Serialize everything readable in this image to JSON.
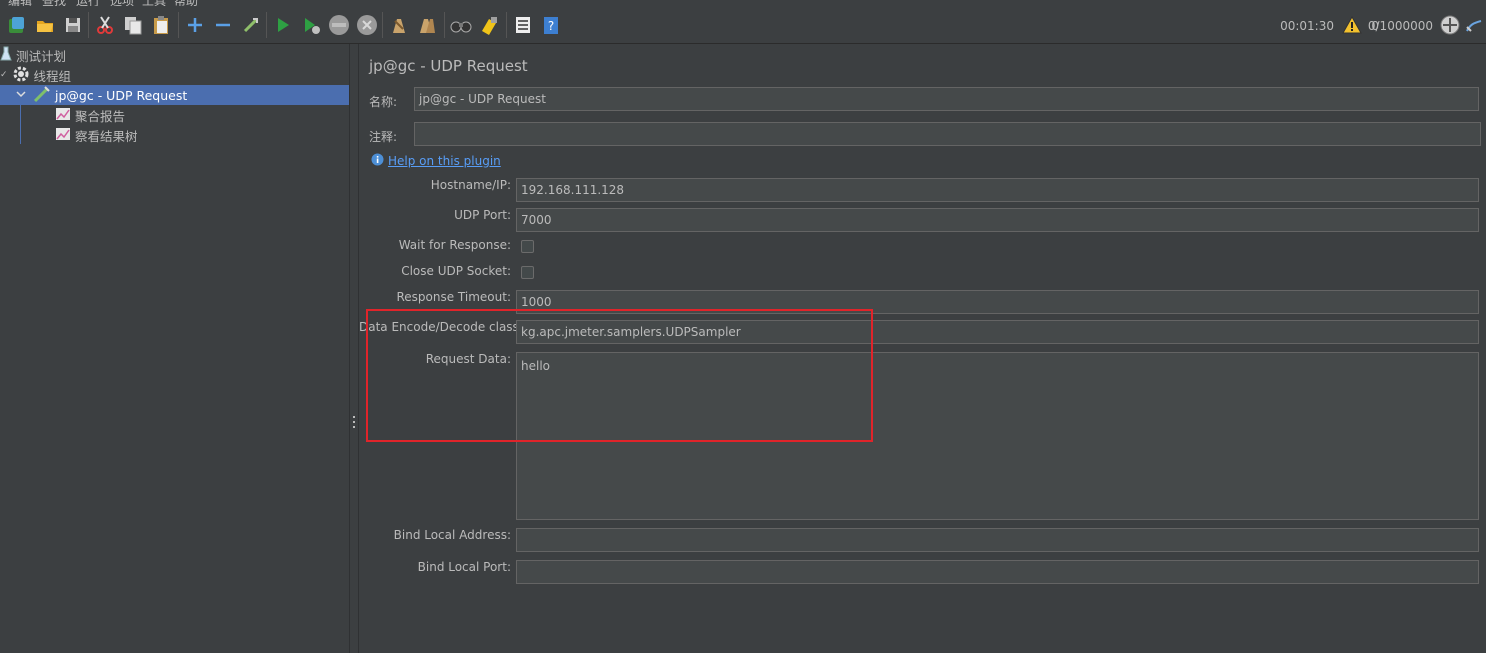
{
  "menu": [
    "编辑",
    "查找",
    "运行",
    "选项",
    "工具",
    "帮助"
  ],
  "toolbar": {
    "icons": [
      "templates-icon",
      "open-icon",
      "save-icon",
      "cut-icon",
      "copy-icon",
      "paste-icon",
      "expand-icon",
      "collapse-icon",
      "toggle-icon",
      "start-icon",
      "start-no-timers-icon",
      "stop-icon",
      "shutdown-icon",
      "clear-icon",
      "clear-all-icon",
      "search-icon",
      "reset-search-icon",
      "function-helper-icon",
      "help-icon"
    ]
  },
  "status": {
    "elapsed": "00:01:30",
    "errors": "0",
    "threads": "0/1000000"
  },
  "tree": {
    "items": [
      {
        "label": "测试计划",
        "icon": "test-plan-icon"
      },
      {
        "label": "线程组",
        "icon": "gear-icon"
      },
      {
        "label": "jp@gc - UDP Request",
        "icon": "sampler-icon",
        "selected": true
      },
      {
        "label": "聚合报告",
        "icon": "listener-icon"
      },
      {
        "label": "察看结果树",
        "icon": "listener-icon"
      }
    ]
  },
  "panel": {
    "title": "jp@gc - UDP Request",
    "name_label": "名称:",
    "name_value": "jp@gc - UDP Request",
    "comment_label": "注释:",
    "comment_value": "",
    "help_link": "Help on this plugin",
    "fields": {
      "hostname_label": "Hostname/IP:",
      "hostname_value": "192.168.111.128",
      "port_label": "UDP Port:",
      "port_value": "7000",
      "wait_label": "Wait for Response:",
      "close_label": "Close UDP Socket:",
      "timeout_label": "Response Timeout:",
      "timeout_value": "1000",
      "encode_label": "Data Encode/Decode class:",
      "encode_value": "kg.apc.jmeter.samplers.UDPSampler",
      "request_label": "Request Data:",
      "request_value": "hello",
      "bind_addr_label": "Bind Local Address:",
      "bind_addr_value": "",
      "bind_port_label": "Bind Local Port:",
      "bind_port_value": ""
    }
  },
  "colors": {
    "background": "#3c3f41",
    "selection": "#4b6eaf",
    "highlight_box": "#e0242a",
    "link": "#589df6"
  }
}
